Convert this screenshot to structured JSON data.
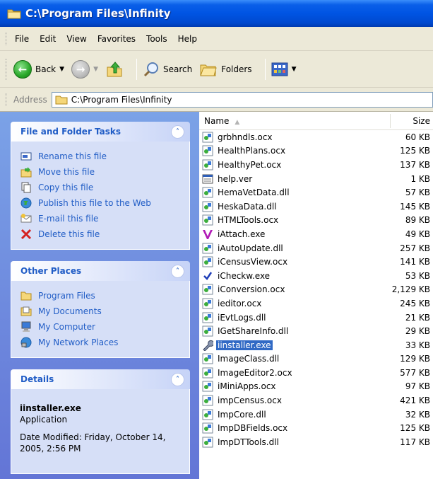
{
  "window": {
    "title": "C:\\Program Files\\Infinity"
  },
  "menu": [
    "File",
    "Edit",
    "View",
    "Favorites",
    "Tools",
    "Help"
  ],
  "toolbar": {
    "back_label": "Back",
    "search_label": "Search",
    "folders_label": "Folders"
  },
  "address": {
    "label": "Address",
    "value": "C:\\Program Files\\Infinity"
  },
  "tasks_panel": {
    "title": "File and Folder Tasks",
    "items": [
      {
        "label": "Rename this file",
        "icon": "rename-icon"
      },
      {
        "label": "Move this file",
        "icon": "move-icon"
      },
      {
        "label": "Copy this file",
        "icon": "copy-icon"
      },
      {
        "label": "Publish this file to the Web",
        "icon": "globe-icon"
      },
      {
        "label": "E-mail this file",
        "icon": "email-icon"
      },
      {
        "label": "Delete this file",
        "icon": "delete-icon"
      }
    ]
  },
  "places_panel": {
    "title": "Other Places",
    "items": [
      {
        "label": "Program Files",
        "icon": "folder-icon"
      },
      {
        "label": "My Documents",
        "icon": "documents-icon"
      },
      {
        "label": "My Computer",
        "icon": "computer-icon"
      },
      {
        "label": "My Network Places",
        "icon": "network-icon"
      }
    ]
  },
  "details_panel": {
    "title": "Details",
    "file_name": "iinstaller.exe",
    "file_type": "Application",
    "date_modified": "Date Modified: Friday, October 14, 2005, 2:56 PM"
  },
  "columns": {
    "name": "Name",
    "size": "Size"
  },
  "files": [
    {
      "name": "grbhndls.ocx",
      "size": "60 KB",
      "icon": "component-icon"
    },
    {
      "name": "HealthPlans.ocx",
      "size": "125 KB",
      "icon": "component-icon"
    },
    {
      "name": "HealthyPet.ocx",
      "size": "137 KB",
      "icon": "component-icon"
    },
    {
      "name": "help.ver",
      "size": "1 KB",
      "icon": "ver-file-icon"
    },
    {
      "name": "HemaVetData.dll",
      "size": "57 KB",
      "icon": "component-icon"
    },
    {
      "name": "HeskaData.dll",
      "size": "145 KB",
      "icon": "component-icon"
    },
    {
      "name": "HTMLTools.ocx",
      "size": "89 KB",
      "icon": "component-icon"
    },
    {
      "name": "iAttach.exe",
      "size": "49 KB",
      "icon": "v-logo-icon"
    },
    {
      "name": "iAutoUpdate.dll",
      "size": "257 KB",
      "icon": "component-icon"
    },
    {
      "name": "iCensusView.ocx",
      "size": "141 KB",
      "icon": "component-icon"
    },
    {
      "name": "iCheckw.exe",
      "size": "53 KB",
      "icon": "checkmark-icon"
    },
    {
      "name": "iConversion.ocx",
      "size": "2,129 KB",
      "icon": "component-icon"
    },
    {
      "name": "ieditor.ocx",
      "size": "245 KB",
      "icon": "component-icon"
    },
    {
      "name": "iEvtLogs.dll",
      "size": "21 KB",
      "icon": "component-icon"
    },
    {
      "name": "IGetShareInfo.dll",
      "size": "29 KB",
      "icon": "component-icon"
    },
    {
      "name": "iinstaller.exe",
      "size": "33 KB",
      "icon": "wrench-icon",
      "selected": true
    },
    {
      "name": "ImageClass.dll",
      "size": "129 KB",
      "icon": "component-icon"
    },
    {
      "name": "ImageEditor2.ocx",
      "size": "577 KB",
      "icon": "component-icon"
    },
    {
      "name": "iMiniApps.ocx",
      "size": "97 KB",
      "icon": "component-icon"
    },
    {
      "name": "impCensus.ocx",
      "size": "421 KB",
      "icon": "component-icon"
    },
    {
      "name": "ImpCore.dll",
      "size": "32 KB",
      "icon": "component-icon"
    },
    {
      "name": "ImpDBFields.ocx",
      "size": "125 KB",
      "icon": "component-icon"
    },
    {
      "name": "ImpDTTools.dll",
      "size": "117 KB",
      "icon": "component-icon"
    }
  ],
  "colors": {
    "title_bar": "#0054e3",
    "task_link": "#215dc6",
    "selection": "#316ac5"
  }
}
